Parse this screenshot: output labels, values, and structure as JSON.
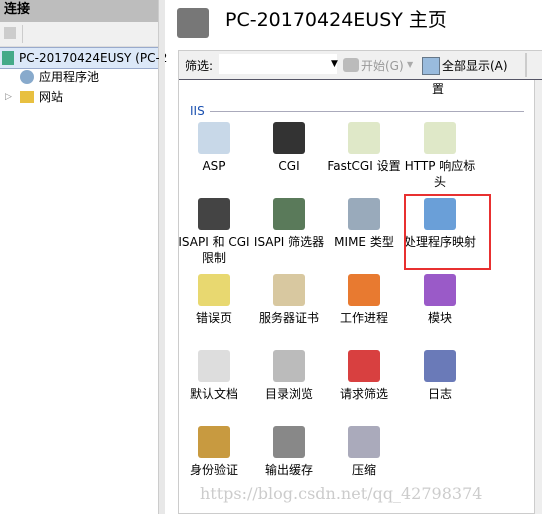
{
  "left": {
    "header": "连接",
    "tree": [
      {
        "label": "PC-20170424EUSY (PC-2",
        "icon": "server-icon"
      },
      {
        "label": "应用程序池",
        "icon": "app-pool-icon"
      },
      {
        "label": "网站",
        "icon": "sites-folder-icon"
      }
    ]
  },
  "main": {
    "title": "PC-20170424EUSY 主页",
    "toolbar": {
      "filter_label": "筛选:",
      "filter_value": "",
      "start": "开始(G)",
      "show_all": "全部显示(A)"
    },
    "partial_label": "置",
    "section": "IIS",
    "items": [
      {
        "label": "ASP",
        "icon": "asp-icon",
        "color": "#c8d8e8"
      },
      {
        "label": "CGI",
        "icon": "cgi-icon",
        "color": "#333333"
      },
      {
        "label": "FastCGI 设置",
        "icon": "fastcgi-icon",
        "color": "#dfe8c8"
      },
      {
        "label": "HTTP 响应标头",
        "icon": "http-response-headers-icon",
        "color": "#dfe8c8"
      },
      {
        "label": "ISAPI 和 CGI 限制",
        "icon": "isapi-cgi-restrictions-icon",
        "color": "#444444"
      },
      {
        "label": "ISAPI 筛选器",
        "icon": "isapi-filters-icon",
        "color": "#5a7a5a"
      },
      {
        "label": "MIME 类型",
        "icon": "mime-types-icon",
        "color": "#9ab"
      },
      {
        "label": "处理程序映射",
        "icon": "handler-mappings-icon",
        "color": "#6a9fd8"
      },
      {
        "label": "错误页",
        "icon": "error-pages-icon",
        "color": "#e8d870"
      },
      {
        "label": "服务器证书",
        "icon": "server-certificates-icon",
        "color": "#d8c8a0"
      },
      {
        "label": "工作进程",
        "icon": "worker-processes-icon",
        "color": "#e87a30"
      },
      {
        "label": "模块",
        "icon": "modules-icon",
        "color": "#9a5ac8"
      },
      {
        "label": "默认文档",
        "icon": "default-document-icon",
        "color": "#ddd"
      },
      {
        "label": "目录浏览",
        "icon": "directory-browsing-icon",
        "color": "#bbb"
      },
      {
        "label": "请求筛选",
        "icon": "request-filtering-icon",
        "color": "#d84040"
      },
      {
        "label": "日志",
        "icon": "logging-icon",
        "color": "#6a7ab8"
      },
      {
        "label": "身份验证",
        "icon": "authentication-icon",
        "color": "#c89a40"
      },
      {
        "label": "输出缓存",
        "icon": "output-caching-icon",
        "color": "#888"
      },
      {
        "label": "压缩",
        "icon": "compression-icon",
        "color": "#aab"
      }
    ]
  },
  "watermark": "https://blog.csdn.net/qq_42798374",
  "colors": {
    "highlight": "#e83030",
    "section": "#1a50b0"
  }
}
